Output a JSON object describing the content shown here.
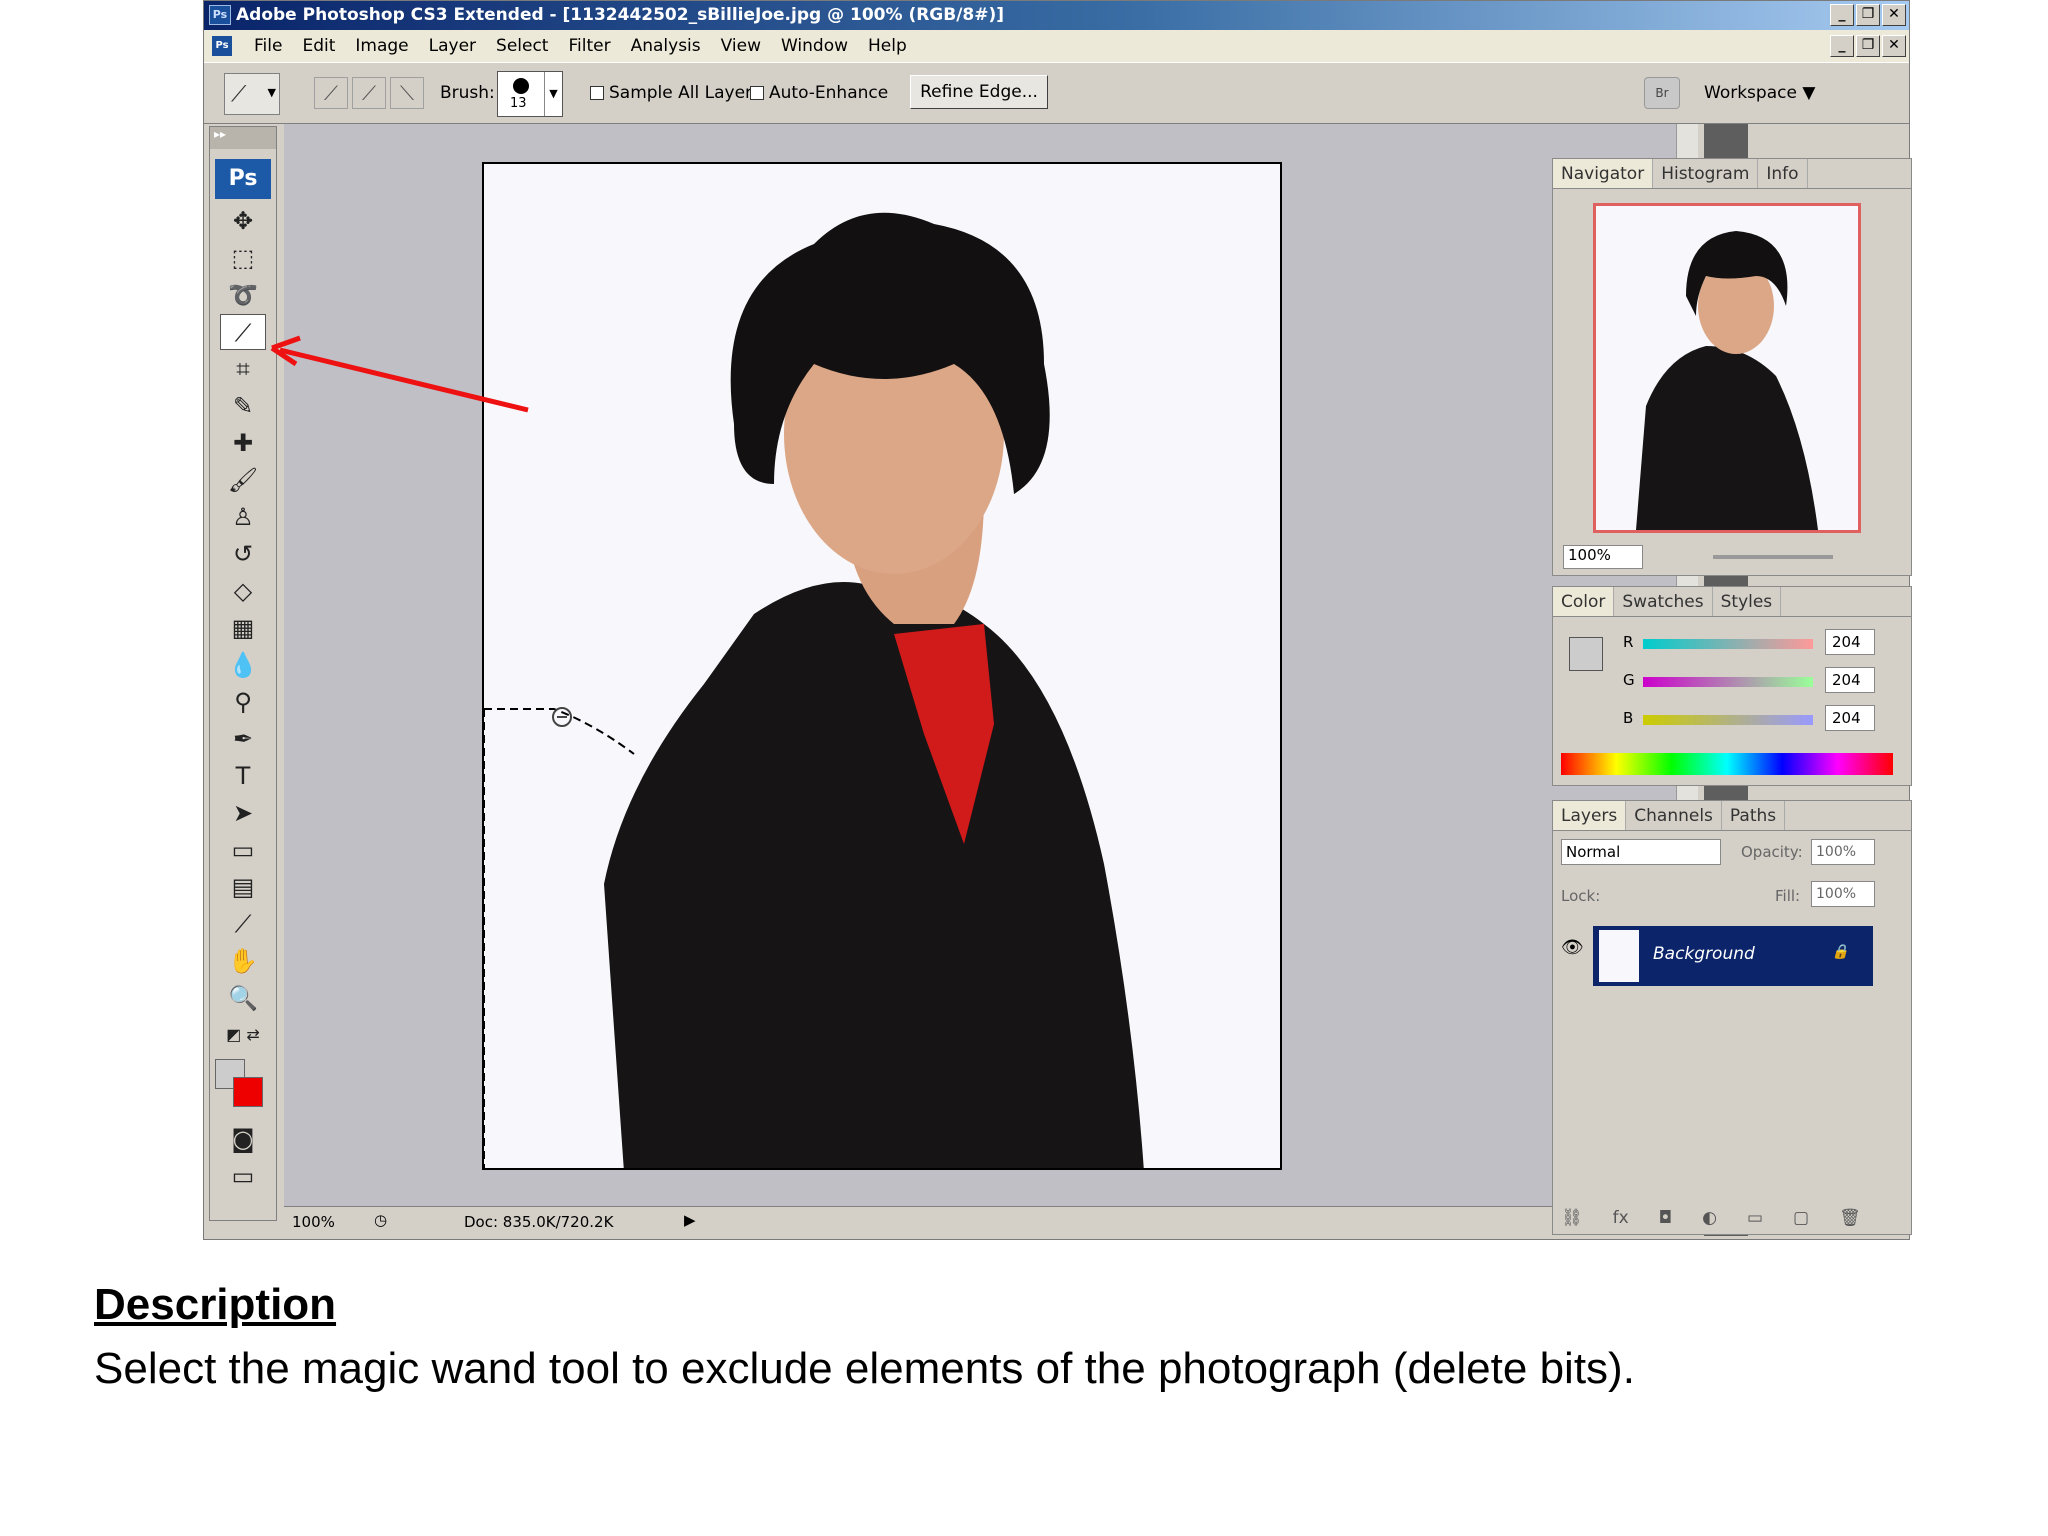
{
  "window": {
    "app_icon": "Ps",
    "title": "Adobe Photoshop CS3 Extended - [1132442502_sBillieJoe.jpg @ 100% (RGB/8#)]",
    "buttons": [
      "_",
      "❐",
      "✕"
    ]
  },
  "menubar": {
    "icon": "Ps",
    "items": [
      "File",
      "Edit",
      "Image",
      "Layer",
      "Select",
      "Filter",
      "Analysis",
      "View",
      "Window",
      "Help"
    ]
  },
  "options": {
    "brush_label": "Brush:",
    "brush_size": "13",
    "sample_all_layers": "Sample All Layers",
    "auto_enhance": "Auto-Enhance",
    "refine_edge": "Refine Edge...",
    "bridge_icon": "Br",
    "workspace": "Workspace ▼"
  },
  "toolbox": {
    "logo": "Ps",
    "active_tool": "quick-selection-tool"
  },
  "statusbar": {
    "zoom": "100%",
    "doc": "Doc: 835.0K/720.2K"
  },
  "navigator": {
    "tabs": [
      "Navigator",
      "Histogram",
      "Info"
    ],
    "zoom": "100%"
  },
  "color": {
    "tabs": [
      "Color",
      "Swatches",
      "Styles"
    ],
    "channels": [
      {
        "label": "R",
        "value": "204"
      },
      {
        "label": "G",
        "value": "204"
      },
      {
        "label": "B",
        "value": "204"
      }
    ],
    "fg_color": "#cccccc",
    "bg_color": "#e00000"
  },
  "layers": {
    "tabs": [
      "Layers",
      "Channels",
      "Paths"
    ],
    "blend_mode": "Normal",
    "opacity_label": "Opacity:",
    "opacity": "100%",
    "lock_label": "Lock:",
    "fill_label": "Fill:",
    "fill": "100%",
    "layer_name": "Background"
  },
  "caption": {
    "title": "Description",
    "body": "Select the magic wand tool to exclude elements of the photograph (delete bits)."
  },
  "colors": {
    "annotation_arrow": "#ee1111",
    "selected_layer": "#0b246a"
  }
}
